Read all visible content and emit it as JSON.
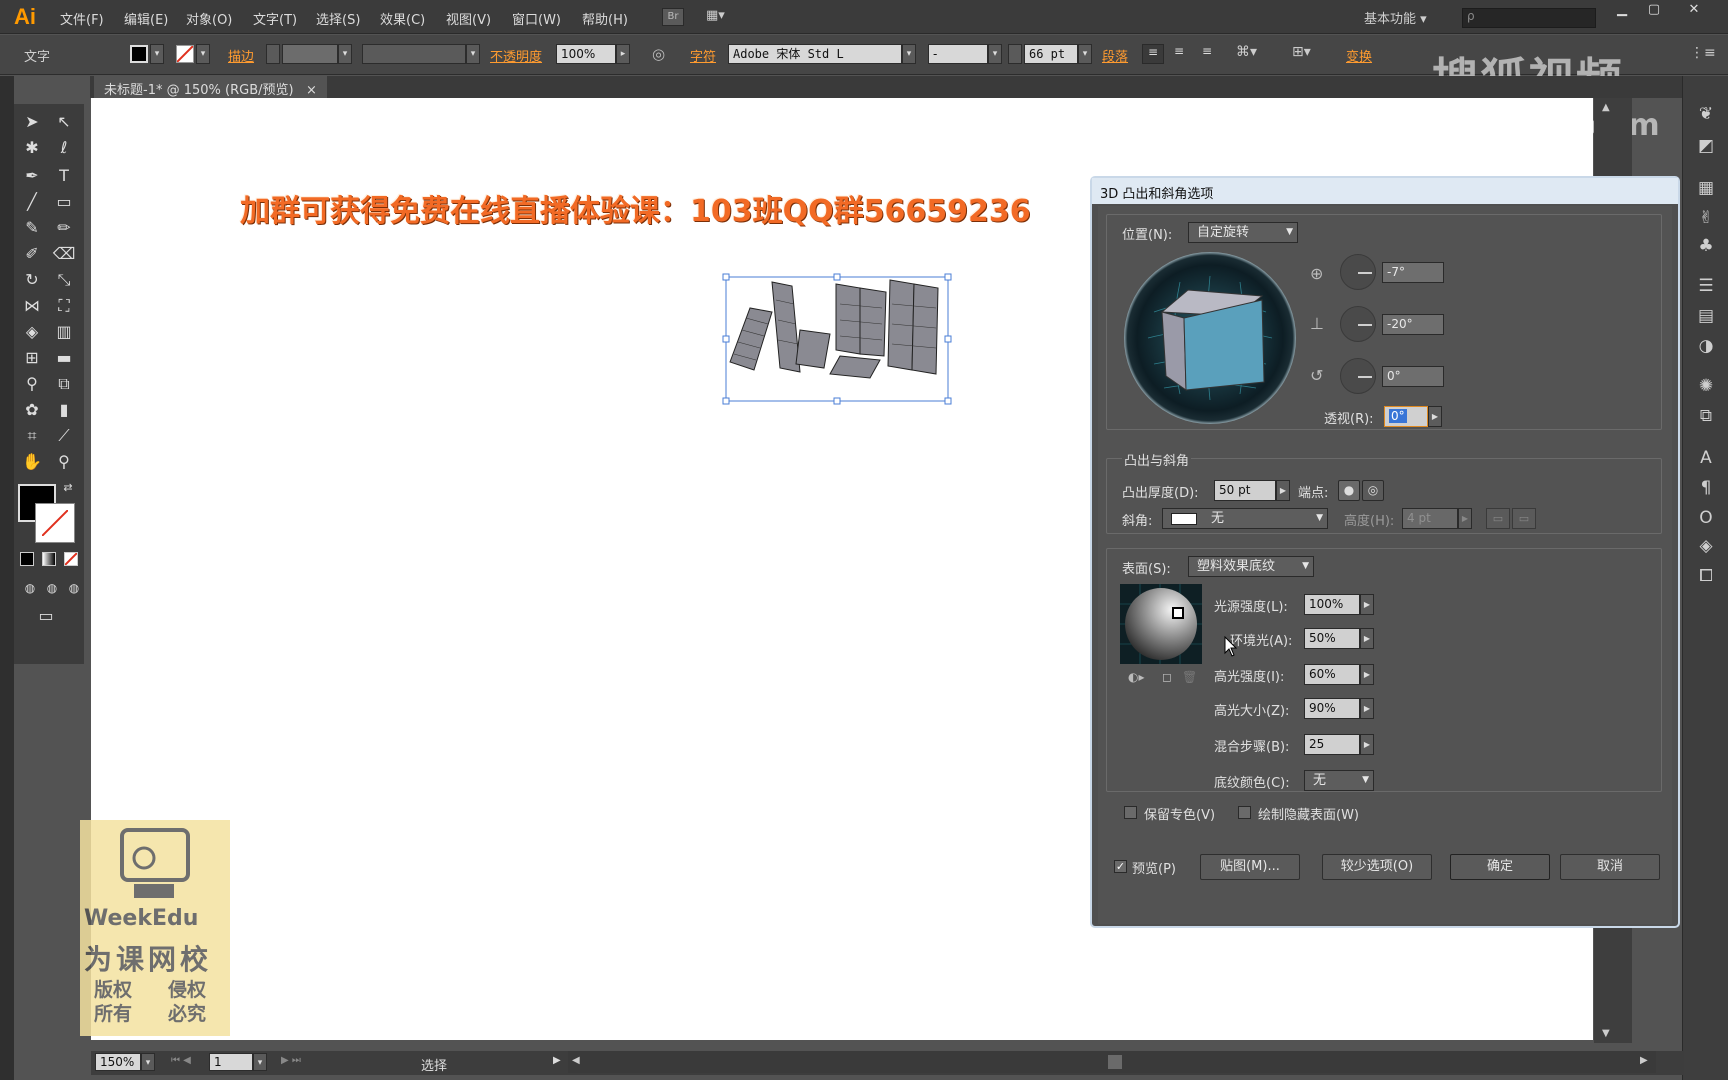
{
  "menubar": {
    "logo": "Ai",
    "items": [
      "文件(F)",
      "编辑(E)",
      "对象(O)",
      "文字(T)",
      "选择(S)",
      "效果(C)",
      "视图(V)",
      "窗口(W)",
      "帮助(H)"
    ],
    "bridge": "Br",
    "workspace": "基本功能",
    "search_placeholder": "ρ"
  },
  "control_bar": {
    "label": "文字",
    "stroke_label": "描边",
    "opacity_label": "不透明度",
    "opacity_value": "100%",
    "character_label": "字符",
    "font_family": "Adobe 宋体 Std L",
    "font_style": "-",
    "font_size": "66 pt",
    "paragraph_label": "段落",
    "transform_label": "变换"
  },
  "watermark": {
    "line1": "搜狐视频",
    "line2": "com"
  },
  "document_tab": {
    "title": "未标题-1* @ 150% (RGB/预览)",
    "close": "×"
  },
  "canvas": {
    "banner": "加群可获得免费在线直播体验课：103班QQ群56659236"
  },
  "edu_watermark": {
    "brand": "WeekEdu",
    "name": "为课网校",
    "rights1": "版权所有",
    "rights2": "侵权必究"
  },
  "status_bar": {
    "zoom": "150%",
    "page": "1",
    "mode": "选择"
  },
  "dialog": {
    "title": "3D 凸出和斜角选项",
    "position_label": "位置(N):",
    "position_value": "自定旋转",
    "rot_x": "-7°",
    "rot_y": "-20°",
    "rot_z": "0°",
    "perspective_label": "透视(R):",
    "perspective_value": "0°",
    "extrude_section": "凸出与斜角",
    "extrude_depth_label": "凸出厚度(D):",
    "extrude_depth_value": "50 pt",
    "cap_label": "端点:",
    "bevel_label": "斜角:",
    "bevel_value": "无",
    "height_label": "高度(H):",
    "height_value": "4 pt",
    "surface_label": "表面(S):",
    "surface_value": "塑料效果底纹",
    "light_intensity_label": "光源强度(L):",
    "light_intensity_value": "100%",
    "ambient_label": "环境光(A):",
    "ambient_value": "50%",
    "highlight_intensity_label": "高光强度(I):",
    "highlight_intensity_value": "60%",
    "highlight_size_label": "高光大小(Z):",
    "highlight_size_value": "90%",
    "blend_steps_label": "混合步骤(B):",
    "blend_steps_value": "25",
    "shading_color_label": "底纹颜色(C):",
    "shading_color_value": "无",
    "preserve_spot_label": "保留专色(V)",
    "draw_hidden_label": "绘制隐藏表面(W)",
    "preview_label": "预览(P)",
    "map_button": "贴图(M)...",
    "fewer_options_button": "较少选项(O)",
    "ok_button": "确定",
    "cancel_button": "取消"
  }
}
